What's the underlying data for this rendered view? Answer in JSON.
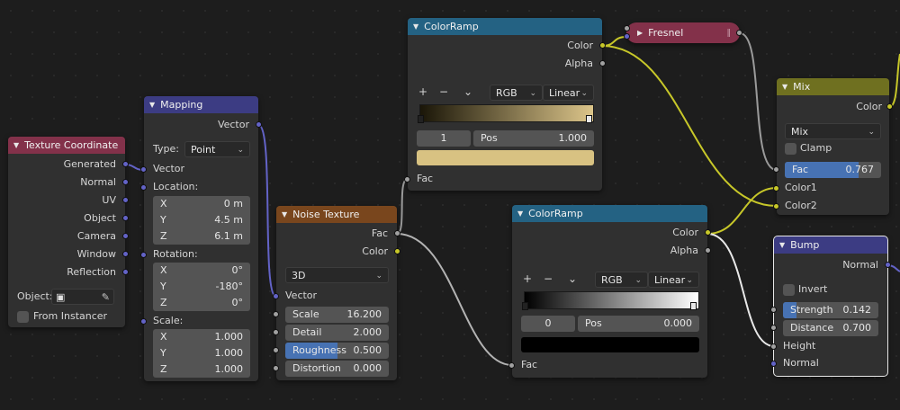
{
  "colors": {
    "background": "#1d1d1d",
    "node_body": "#303030",
    "header_input": "#83314a",
    "header_vector": "#3c3c83",
    "header_converter": "#246283",
    "header_texture": "#79461d",
    "header_color": "#6f7020",
    "socket_vector": "#6363c7",
    "socket_float": "#a1a1a1",
    "socket_color": "#c7c729",
    "slider_fill": "#4772b3",
    "wire_color": "#c7c729",
    "wire_float": "#a1a1a1"
  },
  "icons": {
    "collapse": "chevron-down-icon",
    "object_picker": "cube-icon",
    "eyedropper": "eyedropper-icon",
    "dropdown": "chevron-down-icon"
  },
  "nodes": {
    "texcoord": {
      "title": "Texture Coordinate",
      "outputs": [
        "Generated",
        "Normal",
        "UV",
        "Object",
        "Camera",
        "Window",
        "Reflection"
      ],
      "object_label": "Object:",
      "from_instancer": "From Instancer"
    },
    "mapping": {
      "title": "Mapping",
      "out_vector": "Vector",
      "type_label": "Type:",
      "type_value": "Point",
      "in_vector": "Vector",
      "location_label": "Location:",
      "location": [
        {
          "axis": "X",
          "value": "0 m"
        },
        {
          "axis": "Y",
          "value": "4.5 m"
        },
        {
          "axis": "Z",
          "value": "6.1 m"
        }
      ],
      "rotation_label": "Rotation:",
      "rotation": [
        {
          "axis": "X",
          "value": "0°"
        },
        {
          "axis": "Y",
          "value": "-180°"
        },
        {
          "axis": "Z",
          "value": "0°"
        }
      ],
      "scale_label": "Scale:",
      "scale": [
        {
          "axis": "X",
          "value": "1.000"
        },
        {
          "axis": "Y",
          "value": "1.000"
        },
        {
          "axis": "Z",
          "value": "1.000"
        }
      ]
    },
    "noise": {
      "title": "Noise Texture",
      "out_fac": "Fac",
      "out_color": "Color",
      "dimensions": "3D",
      "in_vector": "Vector",
      "scale_label": "Scale",
      "scale_value": "16.200",
      "detail_label": "Detail",
      "detail_value": "2.000",
      "roughness_label": "Roughness",
      "roughness_value": "0.500",
      "roughness_fraction": 0.5,
      "distortion_label": "Distortion",
      "distortion_value": "0.000"
    },
    "ramp1": {
      "title": "ColorRamp",
      "out_color": "Color",
      "out_alpha": "Alpha",
      "add": "+",
      "remove": "−",
      "color_mode": "RGB",
      "interpolation": "Linear",
      "index": "1",
      "pos_label": "Pos",
      "pos_value": "1.000",
      "stop_color": "#d8c282",
      "gradient_start": "#1a1608",
      "gradient_end": "#dcc58a",
      "in_fac": "Fac"
    },
    "ramp2": {
      "title": "ColorRamp",
      "out_color": "Color",
      "out_alpha": "Alpha",
      "add": "+",
      "remove": "−",
      "color_mode": "RGB",
      "interpolation": "Linear",
      "index": "0",
      "pos_label": "Pos",
      "pos_value": "0.000",
      "stop_color": "#000000",
      "gradient_start": "#000000",
      "gradient_end": "#ffffff",
      "in_fac": "Fac"
    },
    "fresnel": {
      "title": "Fresnel"
    },
    "mix": {
      "title": "Mix",
      "out_color": "Color",
      "blend_mode": "Mix",
      "clamp_label": "Clamp",
      "fac_label": "Fac",
      "fac_value": "0.767",
      "fac_fraction": 0.767,
      "in_color1": "Color1",
      "in_color2": "Color2"
    },
    "bump": {
      "title": "Bump",
      "out_normal": "Normal",
      "invert_label": "Invert",
      "strength_label": "Strength",
      "strength_value": "0.142",
      "strength_fraction": 0.142,
      "distance_label": "Distance",
      "distance_value": "0.700",
      "in_height": "Height",
      "in_normal": "Normal"
    }
  }
}
